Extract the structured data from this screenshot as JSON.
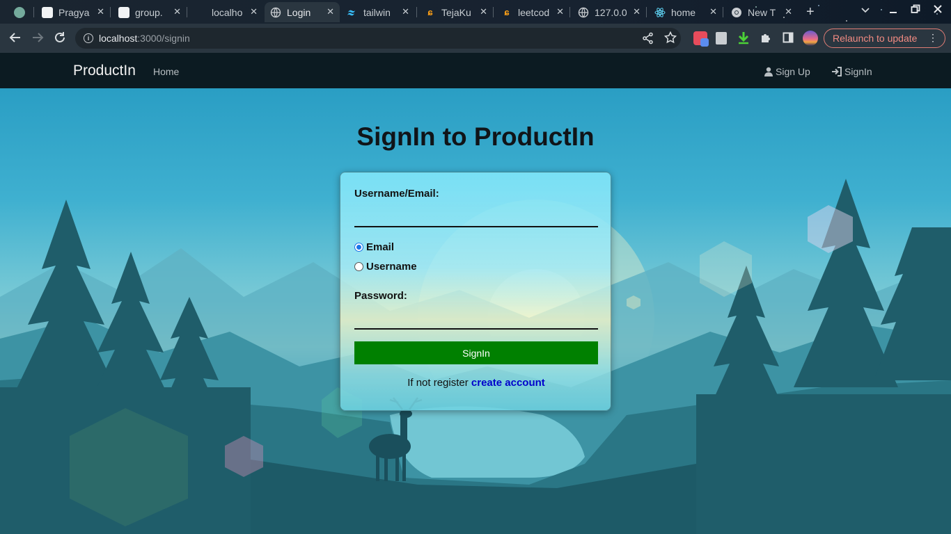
{
  "browser": {
    "tabs": [
      {
        "title": "",
        "icon": "chatgpt-icon"
      },
      {
        "title": "Pragya",
        "icon": "doc-icon"
      },
      {
        "title": "group.",
        "icon": "doc-icon"
      },
      {
        "title": "localho",
        "icon": "blank-icon"
      },
      {
        "title": "Login",
        "icon": "globe-icon",
        "active": true
      },
      {
        "title": "tailwin",
        "icon": "tailwind-icon"
      },
      {
        "title": "TejaKu",
        "icon": "leetcode-icon"
      },
      {
        "title": "leetcod",
        "icon": "leetcode-icon"
      },
      {
        "title": "127.0.0",
        "icon": "globe-icon"
      },
      {
        "title": "home",
        "icon": "react-icon"
      },
      {
        "title": "New T",
        "icon": "chrome-icon"
      }
    ],
    "url_host": "localhost",
    "url_path": ":3000/signin",
    "relaunch_label": "Relaunch to update"
  },
  "navbar": {
    "brand": "ProductIn",
    "home": "Home",
    "signup": "Sign Up",
    "signin": "SignIn"
  },
  "page": {
    "title": "SignIn to ProductIn"
  },
  "form": {
    "username_label": "Username/Email:",
    "username_value": "",
    "radio_email": "Email",
    "radio_username": "Username",
    "selected": "Email",
    "password_label": "Password:",
    "password_value": "",
    "submit_label": "SignIn",
    "register_text": "If not register",
    "register_link": "create account"
  },
  "colors": {
    "navbar_bg": "#0c1b22",
    "submit_bg": "#008000",
    "link": "#0000cc",
    "radio_accent": "#1a73e8"
  }
}
